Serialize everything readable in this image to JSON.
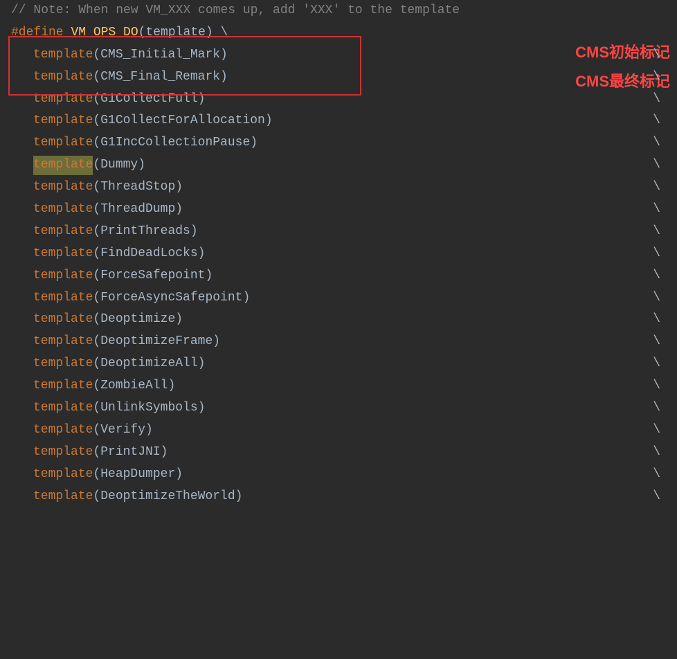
{
  "editor": {
    "background": "#2b2b2b",
    "lines": [
      {
        "id": "comment-line",
        "type": "comment",
        "text": "// Note: When new VM_XXX comes up, add 'XXX' to the template"
      },
      {
        "id": "define-line",
        "type": "define",
        "keyword": "#define",
        "name": "VM_OPS_DO",
        "params": "(template)",
        "suffix": " \\"
      },
      {
        "id": "cms-initial",
        "type": "template-call",
        "keyword": "template",
        "arg": "CMS_Initial_Mark",
        "highlighted": true
      },
      {
        "id": "cms-final",
        "type": "template-call",
        "keyword": "template",
        "arg": "CMS_Final_Remark",
        "highlighted": true
      },
      {
        "id": "g1-full",
        "type": "template-call",
        "keyword": "template",
        "arg": "G1CollectFull"
      },
      {
        "id": "g1-alloc",
        "type": "template-call",
        "keyword": "template",
        "arg": "G1CollectForAllocation"
      },
      {
        "id": "g1-inc",
        "type": "template-call",
        "keyword": "template",
        "arg": "G1IncCollectionPause"
      },
      {
        "id": "dummy",
        "type": "template-call",
        "keyword": "template",
        "arg": "Dummy",
        "dummy": true
      },
      {
        "id": "thread-stop",
        "type": "template-call",
        "keyword": "template",
        "arg": "ThreadStop"
      },
      {
        "id": "thread-dump",
        "type": "template-call",
        "keyword": "template",
        "arg": "ThreadDump"
      },
      {
        "id": "print-threads",
        "type": "template-call",
        "keyword": "template",
        "arg": "PrintThreads"
      },
      {
        "id": "find-deadlocks",
        "type": "template-call",
        "keyword": "template",
        "arg": "FindDeadLocks"
      },
      {
        "id": "force-safepoint",
        "type": "template-call",
        "keyword": "template",
        "arg": "ForceSafepoint"
      },
      {
        "id": "force-async",
        "type": "template-call",
        "keyword": "template",
        "arg": "ForceAsyncSafepoint"
      },
      {
        "id": "deoptimize",
        "type": "template-call",
        "keyword": "template",
        "arg": "Deoptimize"
      },
      {
        "id": "deoptimize-frame",
        "type": "template-call",
        "keyword": "template",
        "arg": "DeoptimizeFrame"
      },
      {
        "id": "deoptimize-all",
        "type": "template-call",
        "keyword": "template",
        "arg": "DeoptimizeAll"
      },
      {
        "id": "zombie-all",
        "type": "template-call",
        "keyword": "template",
        "arg": "ZombieAll"
      },
      {
        "id": "unlink-symbols",
        "type": "template-call",
        "keyword": "template",
        "arg": "UnlinkSymbols"
      },
      {
        "id": "verify",
        "type": "template-call",
        "keyword": "template",
        "arg": "Verify"
      },
      {
        "id": "print-jni",
        "type": "template-call",
        "keyword": "template",
        "arg": "PrintJNI"
      },
      {
        "id": "heap-dumper",
        "type": "template-call",
        "keyword": "template",
        "arg": "HeapDumper"
      },
      {
        "id": "deoptimize-world",
        "type": "template-call",
        "keyword": "template",
        "arg": "DeoptimizeTheWorld"
      }
    ],
    "annotations": [
      {
        "id": "ann-1",
        "text": "CMS初始标记",
        "class": "annotation-1"
      },
      {
        "id": "ann-2",
        "text": "CMS最终标记",
        "class": "annotation-2"
      }
    ]
  }
}
